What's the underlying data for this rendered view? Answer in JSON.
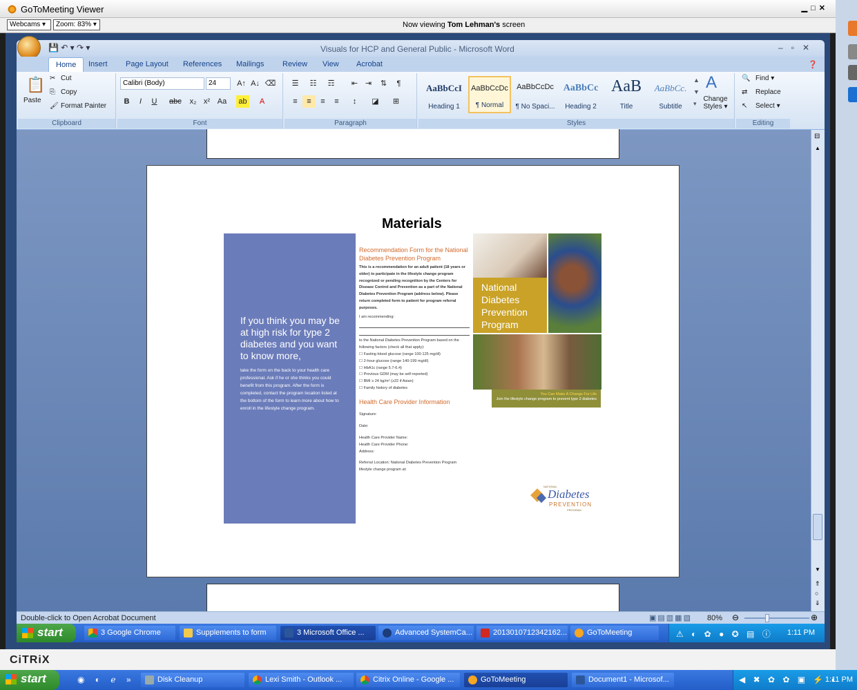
{
  "viewer": {
    "title": "GoToMeeting Viewer",
    "webcams_label": "Webcams ▾",
    "zoom_label": "Zoom: 83% ▾",
    "viewing_prefix": "Now viewing ",
    "viewing_name": "Tom Lehman's",
    "viewing_suffix": " screen"
  },
  "word": {
    "title": "Visuals for HCP and General Public - Microsoft Word",
    "tabs": [
      "Home",
      "Insert",
      "Page Layout",
      "References",
      "Mailings",
      "Review",
      "View",
      "Acrobat"
    ],
    "clipboard": {
      "paste": "Paste",
      "cut": "Cut",
      "copy": "Copy",
      "format_painter": "Format Painter",
      "label": "Clipboard"
    },
    "font": {
      "name": "Calibri (Body)",
      "size": "24",
      "label": "Font"
    },
    "paragraph": {
      "label": "Paragraph"
    },
    "styles": {
      "label": "Styles",
      "tiles": [
        {
          "sample": "AaBbCcI",
          "name": "Heading 1"
        },
        {
          "sample": "AaBbCcDc",
          "name": "¶ Normal"
        },
        {
          "sample": "AaBbCcDc",
          "name": "¶ No Spaci..."
        },
        {
          "sample": "AaBbCc",
          "name": "Heading 2"
        },
        {
          "sample": "AaB",
          "name": "Title"
        },
        {
          "sample": "AaBbCc.",
          "name": "Subtitle"
        }
      ],
      "change_styles": "Change Styles ▾"
    },
    "editing": {
      "find": "Find ▾",
      "replace": "Replace",
      "select": "Select ▾",
      "label": "Editing"
    },
    "status_text": "Double-click to Open Acrobat Document",
    "zoom_percent": "80%"
  },
  "document": {
    "heading": "Materials",
    "purple_big": "If you think you may be at high risk for type 2 diabetes and you want to know more,",
    "purple_small": "take the form on the back to your health care professional. Ask if he or she thinks you could benefit from this program. After the form is completed, contact the program location listed at the bottom of the form to learn more about how to enroll in the lifestyle change program.",
    "form_heading": "Recommendation Form for the National Diabetes Prevention Program",
    "form_intro": "This is a recommendation for an adult patient (18 years or older) to participate in the lifestyle change program recognized or pending recognition by the Centers for Disease Control and Prevention as a part of the National Diabetes Prevention Program (address below). Please return completed form to patient for program referral purposes.",
    "recommending": "I am recommending:",
    "based_on": "to the National Diabetes Prevention Program based on the following factors (check all that apply):",
    "factors": [
      "☐ Fasting blood glucose (range 100-125 mg/dl)",
      "☐ 2-hour glucose (range 140-199 mg/dl)",
      "☐ HbA1c (range 5.7-6.4)",
      "☐ Previous GDM (may be self-reported)",
      "☐ BMI ≥ 24 kg/m² (≥22 if Asian)",
      "☐ Family history of diabetes"
    ],
    "hcp_heading": "Health Care Provider Information",
    "signature": "Signature:",
    "date": "Date:",
    "hcp_name": "Health Care Provider Name:",
    "hcp_phone": "Health Care Provider Phone:",
    "address": "Address:",
    "referral": "Referral Location: National Diabetes Prevention Program lifestyle change program at:",
    "ndpp_box": "National Diabetes Prevention Program",
    "banner_1": "You Can Make A Change For Life",
    "banner_2": "Join the lifestyle change program to prevent type 2 diabetes",
    "logo_small": "NATIONAL",
    "logo_main": "Diabetes",
    "logo_sub": "PREVENTION",
    "logo_tail": "PROGRAM"
  },
  "inner_taskbar": {
    "start": "start",
    "items": [
      "3 Google Chrome",
      "Supplements to form",
      "3 Microsoft Office ...",
      "Advanced SystemCa...",
      "2013010712342162...",
      "GoToMeeting"
    ],
    "clock": "1:11 PM"
  },
  "citrix": {
    "logo": "CiTRiX"
  },
  "outer_taskbar": {
    "start": "start",
    "items": [
      "Disk Cleanup",
      "Lexi Smith - Outlook ...",
      "Citrix Online - Google ...",
      "GoToMeeting",
      "Document1 - Microsof..."
    ],
    "clock": "1:11 PM"
  },
  "colors": {
    "accent_orange": "#d26a2c",
    "purple_panel": "#6b7cba",
    "ndpp_gold": "#c9a227",
    "xp_blue": "#245ec8"
  }
}
